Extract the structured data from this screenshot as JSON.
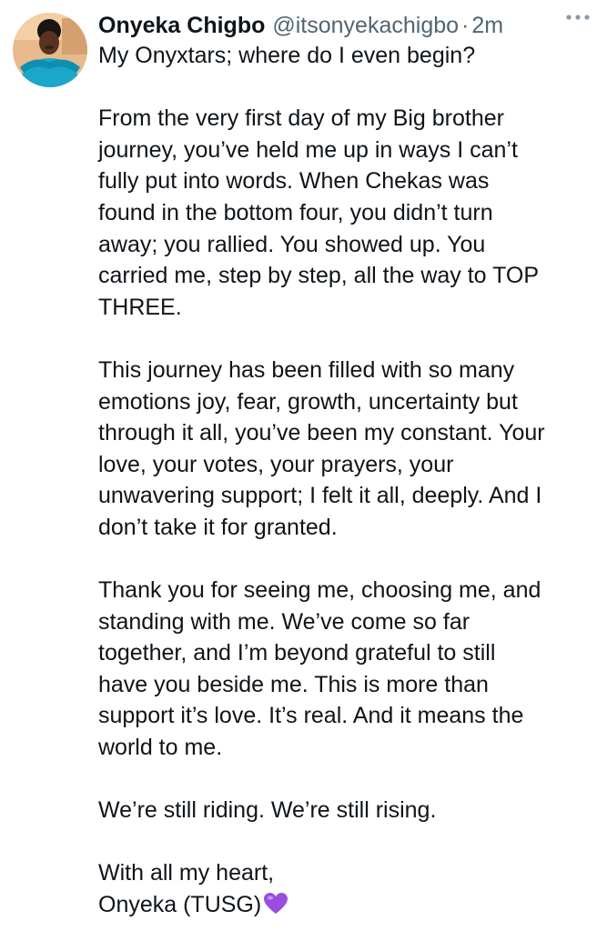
{
  "author": {
    "display_name": "Onyeka Chigbo",
    "handle": "@itsonyekachigbo",
    "separator": "·",
    "time": "2m"
  },
  "icons": {
    "more": "more-options-icon",
    "heart": "purple-heart-emoji"
  },
  "colors": {
    "text": "#0f1419",
    "muted": "#536471",
    "heart": "#9b4de0"
  },
  "tweet": {
    "paragraphs": [
      [
        "My Onyxtars; where do I even begin?"
      ],
      [
        "From the very first day of my Big brother",
        "journey, you’ve held me up in ways I can’t",
        "fully put into words. When Chekas was",
        "found in the bottom four, you didn’t turn",
        "away; you rallied. You showed up. You",
        "carried me, step by step, all the way to TOP",
        "THREE."
      ],
      [
        "This journey has been filled with so many",
        "emotions joy, fear, growth, uncertainty but",
        "through it all, you’ve been my constant. Your",
        "love, your votes, your prayers, your",
        "unwavering support; I felt it all, deeply. And I",
        "don’t take it for granted."
      ],
      [
        "Thank you for seeing me, choosing me, and",
        "standing with me. We’ve come so far",
        "together, and I’m beyond grateful to still",
        "have you beside me. This is more than",
        "support it’s love. It’s real. And it means the",
        "world to me."
      ],
      [
        "We’re still riding. We’re still rising."
      ],
      [
        "With all my heart,",
        "Onyeka (TUSG)"
      ]
    ]
  }
}
